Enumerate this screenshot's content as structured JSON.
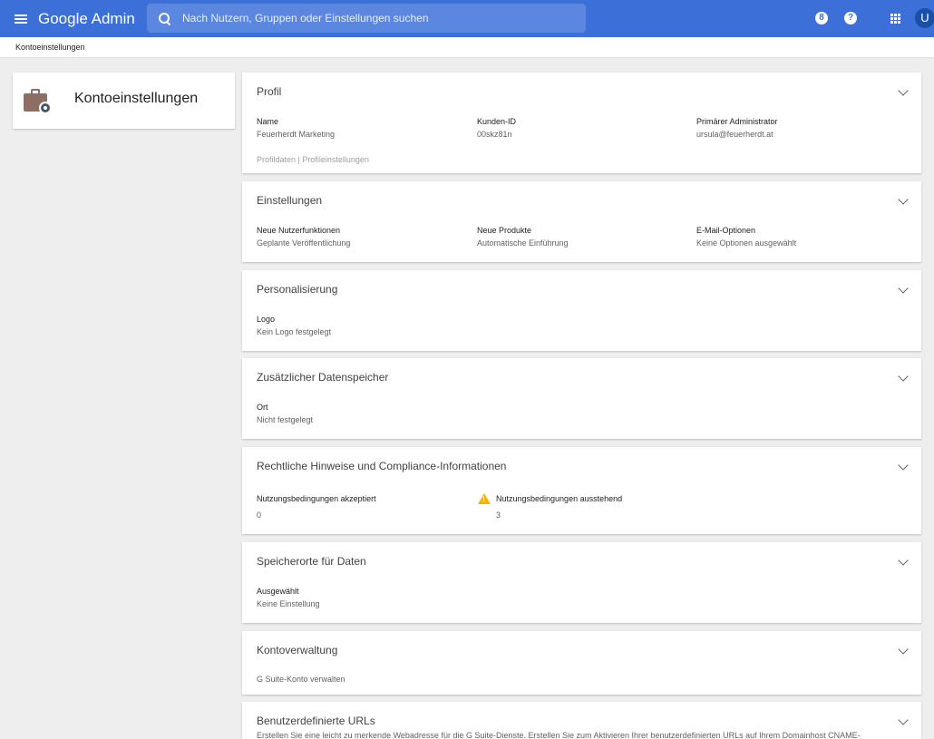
{
  "header": {
    "brand_google": "Google",
    "brand_admin": "Admin",
    "search_placeholder": "Nach Nutzern, Gruppen oder Einstellungen suchen",
    "avatar_letter": "U",
    "notif_badge": "8",
    "help_icon_glyph": "?"
  },
  "breadcrumb": "Kontoeinstellungen",
  "left_card": {
    "title": "Kontoeinstellungen"
  },
  "cards": {
    "profil": {
      "title": "Profil",
      "fields": [
        {
          "label": "Name",
          "value": "Feuerherdt Marketing"
        },
        {
          "label": "Kunden-ID",
          "value": "00skz81n"
        },
        {
          "label": "Primärer Administrator",
          "value": "ursula@feuerherdt.at"
        }
      ],
      "link_profildaten": "Profildaten",
      "link_separator": " | ",
      "link_profileinstellungen": "Profileinstellungen"
    },
    "einstellungen": {
      "title": "Einstellungen",
      "fields": [
        {
          "label": "Neue Nutzerfunktionen",
          "value": "Geplante Veröffentlichung"
        },
        {
          "label": "Neue Produkte",
          "value": "Automatische Einführung"
        },
        {
          "label": "E-Mail-Optionen",
          "value": "Keine Optionen ausgewählt"
        }
      ]
    },
    "personalisierung": {
      "title": "Personalisierung",
      "fields": [
        {
          "label": "Logo",
          "value": "Kein Logo festgelegt"
        }
      ]
    },
    "datenspeicher": {
      "title": "Zusätzlicher Datenspeicher",
      "fields": [
        {
          "label": "Ort",
          "value": "Nicht festgelegt"
        }
      ]
    },
    "rechtliches": {
      "title": "Rechtliche Hinweise und Compliance-Informationen",
      "fields": [
        {
          "label": "Nutzungsbedingungen akzeptiert",
          "value": "0"
        },
        {
          "label": "Nutzungsbedingungen ausstehend",
          "value": "3"
        }
      ],
      "warning_color": "#f4b400"
    },
    "speicherorte": {
      "title": "Speicherorte für Daten",
      "fields": [
        {
          "label": "Ausgewählt",
          "value": "Keine Einstellung"
        }
      ]
    },
    "kontoverwaltung": {
      "title": "Kontoverwaltung",
      "link": "G Suite-Konto verwalten"
    },
    "urls": {
      "title": "Benutzerdefinierte URLs",
      "description": "Erstellen Sie eine leicht zu merkende Webadresse für die G Suite-Dienste. Erstellen Sie zum Aktivieren Ihrer benutzerdefinierten URLs auf Ihrem Domainhost CNAME-"
    }
  },
  "colors": {
    "header_bg": "#3c6fd8",
    "search_bg": "#5b87e0",
    "page_bg": "#eeeeee",
    "avatar_bg": "#1a4fa8"
  }
}
